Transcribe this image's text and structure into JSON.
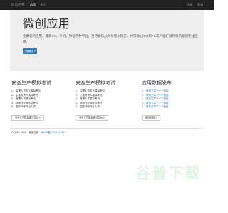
{
  "navbar": {
    "brand": "微信应用",
    "links": [
      {
        "label": "首页",
        "active": true
      },
      {
        "label": "关于",
        "active": false
      }
    ],
    "right": [
      "注册",
      "登录"
    ]
  },
  "hero": {
    "title": "微创应用",
    "text": "免安装的应用，兼容PC、手机、微信各种平台，支持微信公众号接入绑定，并可通过App和PC客户端扩展特殊功能的在线应用。",
    "button": "了解更多 »"
  },
  "columns": [
    {
      "title": "安全生产模拟考试",
      "items": [
        {
          "num": "1.",
          "text": "监理人员执业模拟考试"
        },
        {
          "num": "2.",
          "text": "主要负责人模拟考试"
        },
        {
          "num": "3.",
          "text": "管理人员模拟考试"
        },
        {
          "num": "4.",
          "text": "特种作业操作证考试"
        },
        {
          "num": "5.",
          "text": "国家特种作业人员"
        }
      ],
      "button": "安全生产模拟考试平台 »"
    },
    {
      "title": "安全生产模拟考试",
      "items": [
        {
          "num": "1.",
          "text": "监理人员执业模拟考试"
        },
        {
          "num": "2.",
          "text": "主要负责人模拟考试"
        },
        {
          "num": "3.",
          "text": "管理人员模拟考试"
        },
        {
          "num": "4.",
          "text": "特种作业操作证考试"
        },
        {
          "num": "5.",
          "text": "国家特种作业人员"
        }
      ],
      "button": "安全生产模拟考试平台 »"
    },
    {
      "title": "应用数据发布",
      "items": [
        {
          "num": "1.",
          "text": "微信文章下一个链接"
        },
        {
          "num": "2.",
          "text": "微信文章下一个链接"
        },
        {
          "num": "3.",
          "text": "微信文章下一个链接"
        },
        {
          "num": "4.",
          "text": "微信文章下一个链接"
        },
        {
          "num": "5.",
          "text": "微信文章下一个链接"
        }
      ],
      "button": "微信应用 »"
    }
  ],
  "footer": {
    "copyright": "© 2016-2024 · 微信应用 ·",
    "beian": "闽ICP备16020415号-1"
  },
  "watermark": {
    "text": "谷普下载"
  },
  "colors": {
    "navbar": "#222222",
    "jumbotron": "#eeeeee",
    "primary": "#337ab7",
    "link": "#337ab7",
    "watermark": "#e1f4e4"
  }
}
